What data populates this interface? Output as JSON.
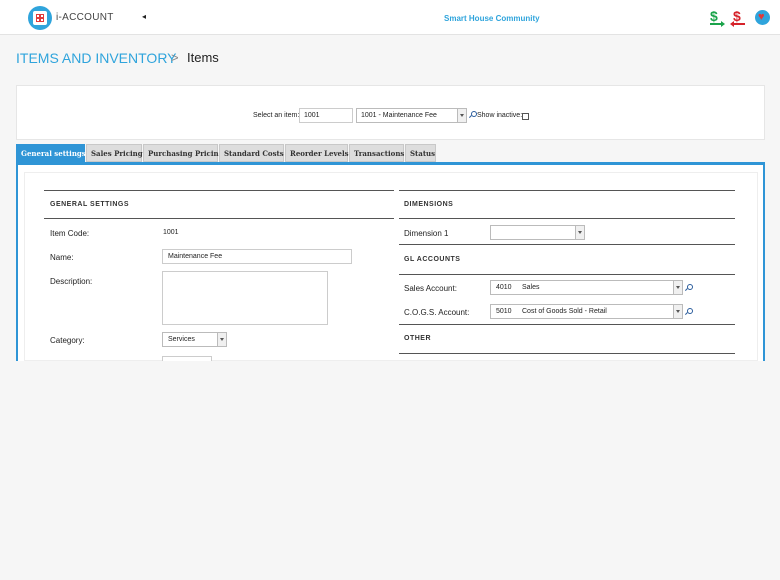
{
  "header": {
    "brand": "i-ACCOUNT",
    "collapse_glyph": "◂",
    "community": "Smart House Community",
    "icons": [
      "logo-icon",
      "payment-in-icon",
      "payment-out-icon",
      "favorite-icon"
    ],
    "pay_glyph": "$"
  },
  "breadcrumb": {
    "section": "ITEMS AND INVENTORY",
    "separator": ">",
    "page": "Items"
  },
  "selector": {
    "label": "Select an item:",
    "code_value": "1001",
    "item_value": "1001 - Maintenance Fee",
    "show_inactive_label": "Show inactive:",
    "show_inactive_checked": false
  },
  "tabs": [
    {
      "label": "General settings",
      "active": true
    },
    {
      "label": "Sales Pricing",
      "active": false
    },
    {
      "label": "Purchasing Pricing",
      "active": false
    },
    {
      "label": "Standard Costs",
      "active": false
    },
    {
      "label": "Reorder Levels",
      "active": false
    },
    {
      "label": "Transactions",
      "active": false
    },
    {
      "label": "Status",
      "active": false
    }
  ],
  "general": {
    "title": "GENERAL SETTINGS",
    "item_code_label": "Item Code:",
    "item_code_value": "1001",
    "name_label": "Name:",
    "name_value": "Maintenance Fee",
    "description_label": "Description:",
    "description_value": "",
    "category_label": "Category:",
    "category_value": "Services"
  },
  "dimensions": {
    "title": "DIMENSIONS",
    "dimension1_label": "Dimension 1",
    "dimension1_value": ""
  },
  "gl_accounts": {
    "title": "GL ACCOUNTS",
    "sales_label": "Sales Account:",
    "sales_code": "4010",
    "sales_name": "Sales",
    "cogs_label": "C.O.G.S. Account:",
    "cogs_code": "5010",
    "cogs_name": "Cost of Goods Sold - Retail"
  },
  "other": {
    "title": "OTHER"
  },
  "colors": {
    "accent": "#2f95d6",
    "brand": "#2fa4dc",
    "pay_in": "#1aa34a",
    "pay_out": "#d6222a"
  }
}
